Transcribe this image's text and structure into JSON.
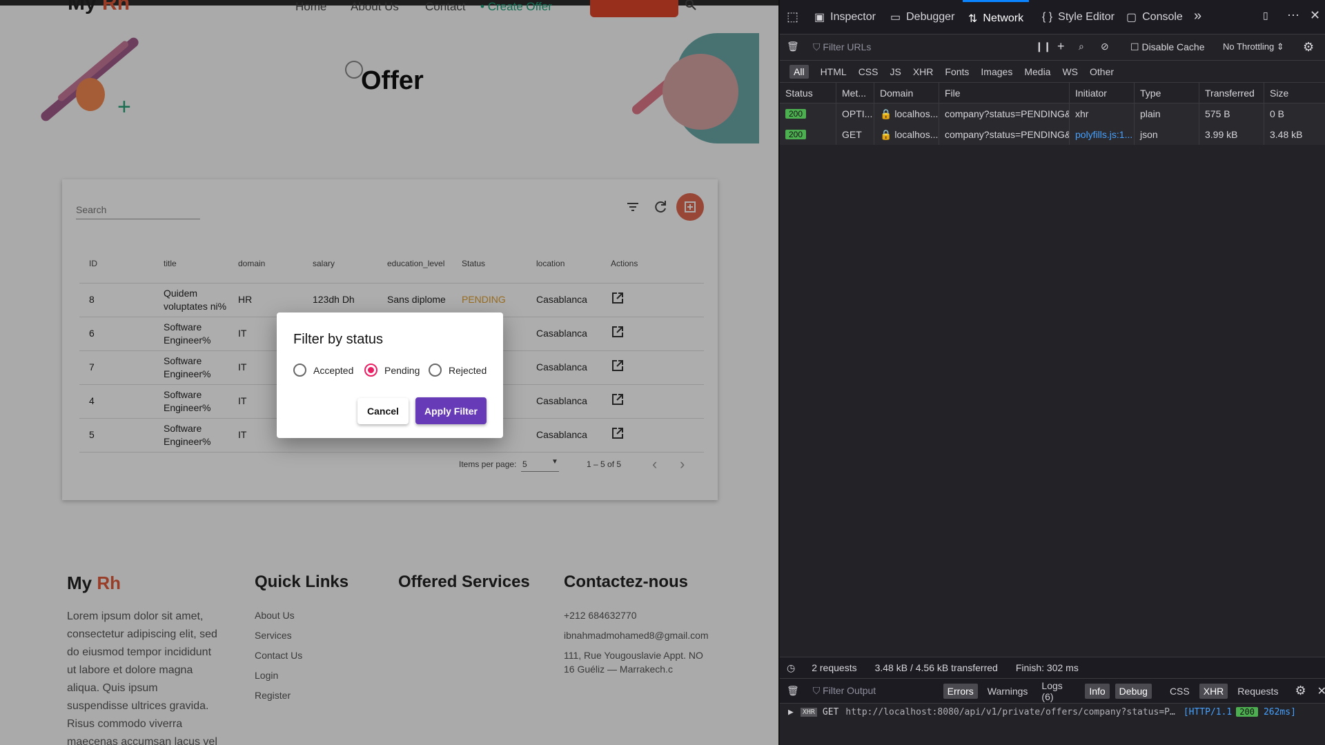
{
  "site": {
    "logo_main": "My",
    "logo_accent": "Rh",
    "nav": [
      "Home",
      "About Us",
      "Contact",
      "Create Offer"
    ],
    "page_title": "Offer"
  },
  "offers": {
    "search_placeholder": "Search",
    "columns": [
      "ID",
      "title",
      "domain",
      "salary",
      "education_level",
      "Status",
      "location",
      "Actions"
    ],
    "rows": [
      {
        "id": "8",
        "title": "Quidem voluptates ni%",
        "domain": "HR",
        "salary": "123dh Dh",
        "education": "Sans diplome",
        "status": "PENDING",
        "location": "Casablanca"
      },
      {
        "id": "6",
        "title": "Software Engineer%",
        "domain": "IT",
        "salary": "",
        "education": "",
        "status": "",
        "location": "Casablanca"
      },
      {
        "id": "7",
        "title": "Software Engineer%",
        "domain": "IT",
        "salary": "",
        "education": "",
        "status": "",
        "location": "Casablanca"
      },
      {
        "id": "4",
        "title": "Software Engineer%",
        "domain": "IT",
        "salary": "",
        "education": "",
        "status": "",
        "location": "Casablanca"
      },
      {
        "id": "5",
        "title": "Software Engineer%",
        "domain": "IT",
        "salary": "",
        "education": "",
        "status": "",
        "location": "Casablanca"
      }
    ],
    "paginator": {
      "items_label": "Items per page:",
      "page_size": "5",
      "range": "1 – 5 of 5"
    }
  },
  "dialog": {
    "title": "Filter by status",
    "options": [
      "Accepted",
      "Pending",
      "Rejected"
    ],
    "selected": "Pending",
    "cancel_label": "Cancel",
    "apply_label": "Apply Filter"
  },
  "footer": {
    "brand_main": "My",
    "brand_accent": "Rh",
    "about_text": "Lorem ipsum dolor sit amet, consectetur adipiscing elit, sed do eiusmod tempor incididunt ut labore et dolore magna aliqua. Quis ipsum suspendisse ultrices gravida. Risus commodo viverra maecenas accumsan lacus vel",
    "quick_links_title": "Quick Links",
    "quick_links": [
      "About Us",
      "Services",
      "Contact Us",
      "Login",
      "Register"
    ],
    "services_title": "Offered Services",
    "contact_title": "Contactez-nous",
    "phone": "+212 684632770",
    "email": "ibnahmadmohamed8@gmail.com",
    "address_line1": "111, Rue Yougouslavie Appt. NO",
    "address_line2": "16 Guéliz — Marrakech.c"
  },
  "devtools": {
    "tabs": [
      "Inspector",
      "Debugger",
      "Network",
      "Style Editor",
      "Console"
    ],
    "active_tab": "Network",
    "filter_placeholder": "Filter URLs",
    "disable_cache_label": "Disable Cache",
    "throttling": "No Throttling",
    "type_filters": [
      "All",
      "HTML",
      "CSS",
      "JS",
      "XHR",
      "Fonts",
      "Images",
      "Media",
      "WS",
      "Other"
    ],
    "columns": [
      "Status",
      "Met...",
      "Domain",
      "File",
      "Initiator",
      "Type",
      "Transferred",
      "Size"
    ],
    "requests": [
      {
        "status": "200",
        "method": "OPTI...",
        "domain": "localhos...",
        "file": "company?status=PENDING&",
        "initiator": "xhr",
        "type": "plain",
        "transferred": "575 B",
        "size": "0 B"
      },
      {
        "status": "200",
        "method": "GET",
        "domain": "localhos...",
        "file": "company?status=PENDING&",
        "initiator": "polyfills.js:1...",
        "type": "json",
        "transferred": "3.99 kB",
        "size": "3.48 kB"
      }
    ],
    "summary": {
      "requests": "2 requests",
      "transferred": "3.48 kB / 4.56 kB transferred",
      "finish": "Finish: 302 ms"
    },
    "console": {
      "filter_placeholder": "Filter Output",
      "chips": [
        "Errors",
        "Warnings",
        "Logs (6)",
        "Info",
        "Debug",
        "CSS",
        "XHR",
        "Requests"
      ],
      "log_type": "XHR",
      "log_method": "GET",
      "log_url": "http://localhost:8080/api/v1/private/offers/company?status=P…",
      "log_proto": "[HTTP/1.1",
      "log_status": "200",
      "log_time": "262ms]"
    }
  }
}
